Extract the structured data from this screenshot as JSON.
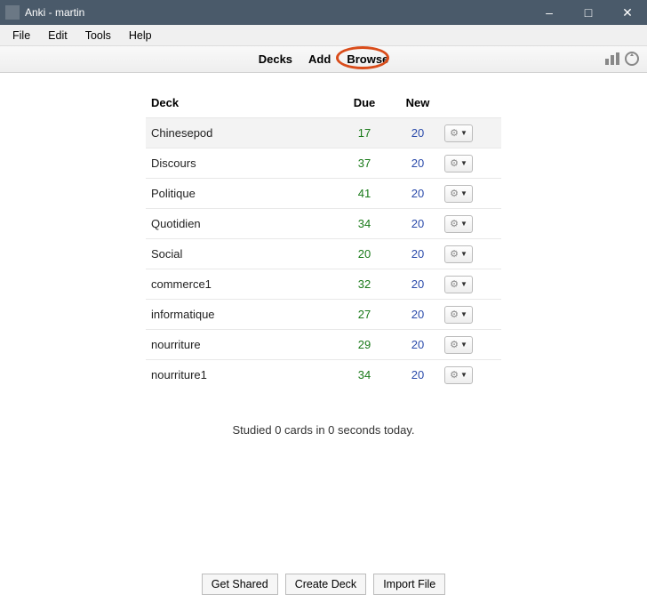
{
  "titlebar": {
    "title": "Anki - martin"
  },
  "menubar": {
    "items": [
      "File",
      "Edit",
      "Tools",
      "Help"
    ]
  },
  "nav": {
    "decks": "Decks",
    "add": "Add",
    "browse": "Browse"
  },
  "columns": {
    "deck": "Deck",
    "due": "Due",
    "new": "New"
  },
  "decks": [
    {
      "name": "Chinesepod",
      "due": "17",
      "new": "20"
    },
    {
      "name": "Discours",
      "due": "37",
      "new": "20"
    },
    {
      "name": "Politique",
      "due": "41",
      "new": "20"
    },
    {
      "name": "Quotidien",
      "due": "34",
      "new": "20"
    },
    {
      "name": "Social",
      "due": "20",
      "new": "20"
    },
    {
      "name": "commerce1",
      "due": "32",
      "new": "20"
    },
    {
      "name": "informatique",
      "due": "27",
      "new": "20"
    },
    {
      "name": "nourriture",
      "due": "29",
      "new": "20"
    },
    {
      "name": "nourriture1",
      "due": "34",
      "new": "20"
    }
  ],
  "summary": "Studied 0 cards in 0 seconds today.",
  "footer": {
    "get_shared": "Get Shared",
    "create_deck": "Create Deck",
    "import_file": "Import File"
  }
}
